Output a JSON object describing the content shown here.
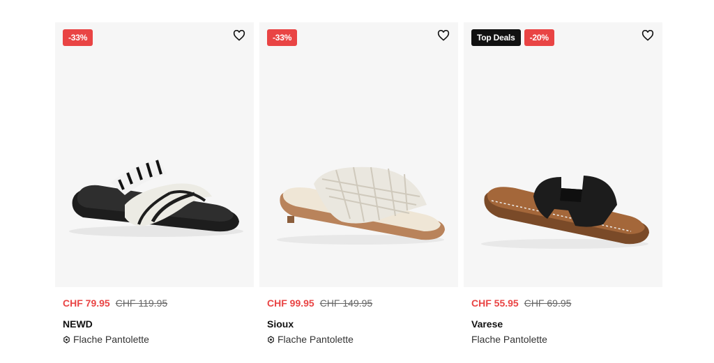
{
  "products": [
    {
      "badges": [
        {
          "kind": "sale",
          "label": "-33%"
        }
      ],
      "price_now": "CHF 79.95",
      "price_old": "CHF 119.95",
      "brand": "NEWD",
      "type": "Flache Pantolette",
      "eco_icon": true
    },
    {
      "badges": [
        {
          "kind": "sale",
          "label": "-33%"
        }
      ],
      "price_now": "CHF 99.95",
      "price_old": "CHF 149.95",
      "brand": "Sioux",
      "type": "Flache Pantolette",
      "eco_icon": true
    },
    {
      "badges": [
        {
          "kind": "deal",
          "label": "Top Deals"
        },
        {
          "kind": "sale",
          "label": "-20%"
        }
      ],
      "price_now": "CHF 55.95",
      "price_old": "CHF 69.95",
      "brand": "Varese",
      "type": "Flache Pantolette",
      "eco_icon": false
    }
  ],
  "colors": {
    "sale": "#e94444",
    "deal": "#111111",
    "card_bg": "#f6f6f6"
  },
  "icons": {
    "favorite": "heart-outline-icon",
    "eco": "sustainability-icon"
  }
}
